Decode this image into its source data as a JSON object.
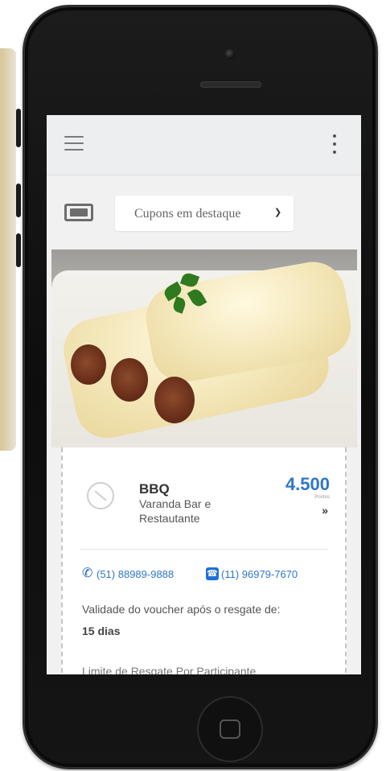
{
  "app": {
    "toolbar": {
      "menu_icon": "hamburger-icon",
      "more_icon": "kebab-icon"
    },
    "filter": {
      "icon": "coupon-icon",
      "selected": "Cupons em destaque",
      "caret_icon": "chevron-down-icon"
    },
    "coupon": {
      "image": "cannelloni-dish-photo",
      "name": "BBQ",
      "subtitle": "Varanda Bar e Restautante",
      "points": "4.500",
      "points_label": "Pontos",
      "more_icon": "double-chevron-icon",
      "phone": "(51) 88989-9888",
      "whatsapp": "(11) 96979-7670",
      "validity_label": "Validade do voucher após o resgate de:",
      "validity_value": "15 dias",
      "next_line": "Limite de Resgate Por Participante"
    }
  },
  "colors": {
    "accent": "#2f77c9",
    "phone_body": "#111111",
    "screen_bg": "#f1f1f1"
  }
}
